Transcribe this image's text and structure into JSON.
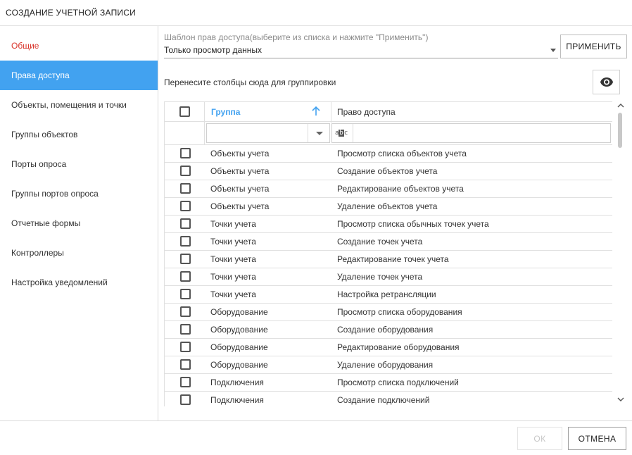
{
  "dialog": {
    "title": "СОЗДАНИЕ УЧЕТНОЙ ЗАПИСИ"
  },
  "sidebar": {
    "items": [
      {
        "label": "Общие"
      },
      {
        "label": "Права доступа"
      },
      {
        "label": "Объекты, помещения и точки"
      },
      {
        "label": "Группы объектов"
      },
      {
        "label": "Порты опроса"
      },
      {
        "label": "Группы портов опроса"
      },
      {
        "label": "Отчетные формы"
      },
      {
        "label": "Контроллеры"
      },
      {
        "label": "Настройка уведомлений"
      }
    ],
    "active_index": 1
  },
  "template": {
    "label": "Шаблон прав доступа(выберите из списка и нажмите \"Применить\")",
    "value": "Только просмотр данных",
    "apply_label": "ПРИМЕНИТЬ"
  },
  "grouping": {
    "hint": "Перенесите столбцы сюда для группировки"
  },
  "grid": {
    "columns": {
      "group": "Группа",
      "permission": "Право доступа"
    },
    "filter": {
      "abc_prefix": "a",
      "abc_mid": "b",
      "abc_suffix": "c"
    },
    "rows": [
      {
        "group": "Объекты учета",
        "permission": "Просмотр списка объектов учета"
      },
      {
        "group": "Объекты учета",
        "permission": "Создание объектов учета"
      },
      {
        "group": "Объекты учета",
        "permission": "Редактирование объектов учета"
      },
      {
        "group": "Объекты учета",
        "permission": "Удаление объектов учета"
      },
      {
        "group": "Точки учета",
        "permission": "Просмотр списка обычных точек учета"
      },
      {
        "group": "Точки учета",
        "permission": "Создание точек учета"
      },
      {
        "group": "Точки учета",
        "permission": "Редактирование точек учета"
      },
      {
        "group": "Точки учета",
        "permission": "Удаление точек учета"
      },
      {
        "group": "Точки учета",
        "permission": "Настройка ретрансляции"
      },
      {
        "group": "Оборудование",
        "permission": "Просмотр списка оборудования"
      },
      {
        "group": "Оборудование",
        "permission": "Создание оборудования"
      },
      {
        "group": "Оборудование",
        "permission": "Редактирование оборудования"
      },
      {
        "group": "Оборудование",
        "permission": "Удаление оборудования"
      },
      {
        "group": "Подключения",
        "permission": "Просмотр списка подключений"
      },
      {
        "group": "Подключения",
        "permission": "Создание подключений"
      }
    ]
  },
  "footer": {
    "ok_label": "ОК",
    "cancel_label": "ОТМЕНА"
  },
  "colors": {
    "accent": "#42a2f0",
    "general_red": "#d9352b"
  }
}
